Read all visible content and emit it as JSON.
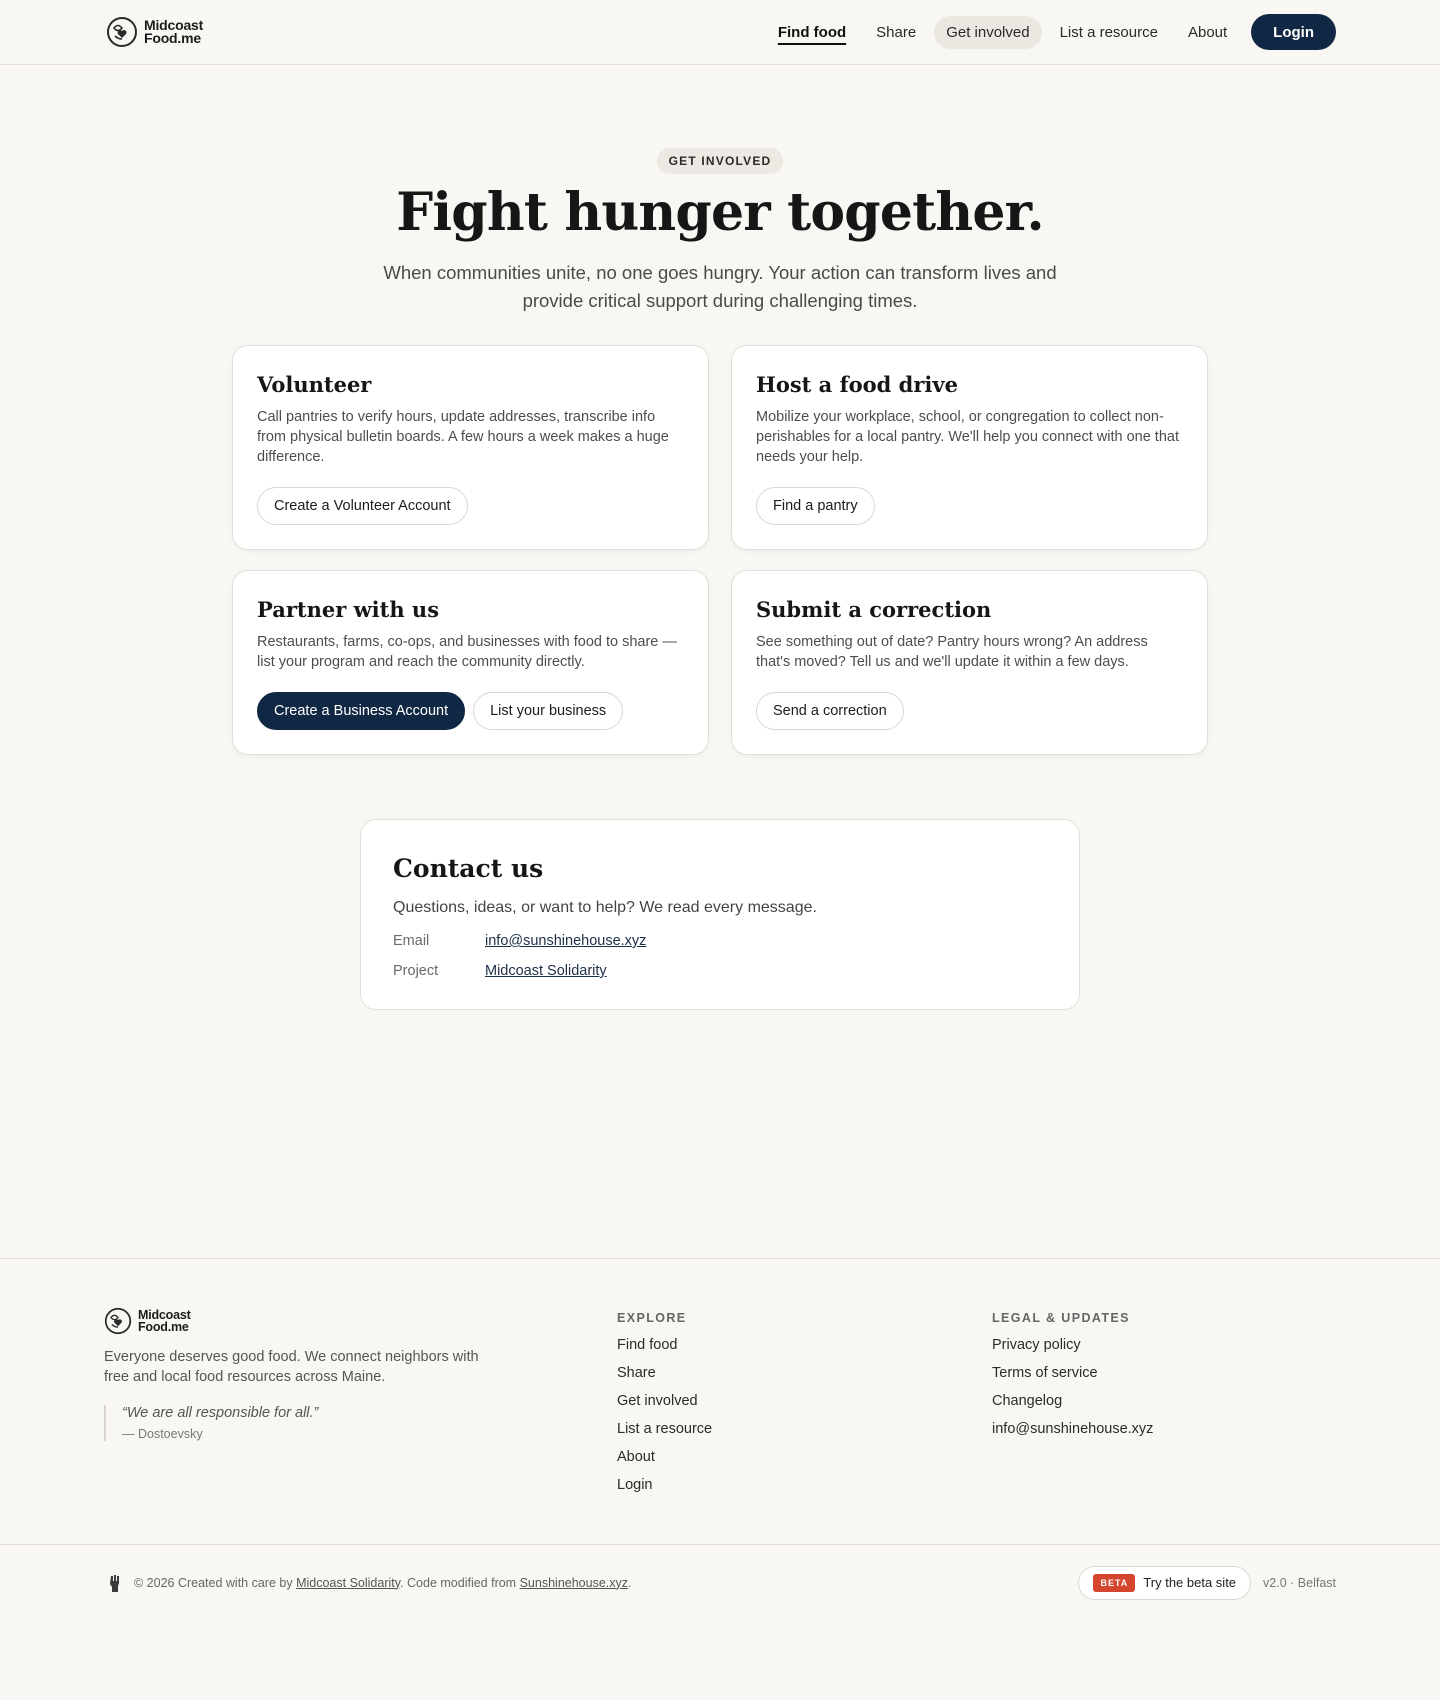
{
  "header": {
    "logo_line1": "Midcoast",
    "logo_line2": "Food.me",
    "nav": [
      {
        "label": "Find food"
      },
      {
        "label": "Share"
      },
      {
        "label": "Get involved"
      },
      {
        "label": "List a resource"
      },
      {
        "label": "About"
      }
    ],
    "login_label": "Login"
  },
  "hero": {
    "eyebrow": "GET INVOLVED",
    "title": "Fight hunger together.",
    "subtitle": "When communities unite, no one goes hungry. Your action can transform lives and provide critical support during challenging times."
  },
  "cards": [
    {
      "title": "Volunteer",
      "text": "Call pantries to verify hours, update addresses, transcribe info from physical bulletin boards. A few hours a week makes a huge difference.",
      "button": "Create a Volunteer Account"
    },
    {
      "title": "Host a food drive",
      "text": "Mobilize your workplace, school, or congregation to collect non-perishables for a local pantry. We'll help you connect with one that needs your help.",
      "button": "Find a pantry"
    },
    {
      "title": "Partner with us",
      "text": "Restaurants, farms, co-ops, and businesses with food to share — list your program and reach the community directly.",
      "button_primary": "Create a Business Account",
      "button": "List your business"
    },
    {
      "title": "Submit a correction",
      "text": "See something out of date? Pantry hours wrong? An address that's moved? Tell us and we'll update it within a few days.",
      "button": "Send a correction"
    }
  ],
  "contact": {
    "title": "Contact us",
    "subtitle": "Questions, ideas, or want to help? We read every message.",
    "email_label": "Email",
    "email_value": "info@sunshinehouse.xyz",
    "project_label": "Project",
    "project_value": "Midcoast Solidarity"
  },
  "footer": {
    "description": "Everyone deserves good food. We connect neighbors with free and local food resources across Maine.",
    "quote": "“We are all responsible for all.”",
    "quote_author": "— Dostoevsky",
    "explore_heading": "EXPLORE",
    "explore_links": [
      "Find food",
      "Share",
      "Get involved",
      "List a resource",
      "About",
      "Login"
    ],
    "legal_heading": "LEGAL & UPDATES",
    "legal_links": [
      "Privacy policy",
      "Terms of service",
      "Changelog",
      "info@sunshinehouse.xyz"
    ],
    "copyright_prefix": "© 2026 Created with care by",
    "copyright_link1": "Midcoast Solidarity",
    "copyright_middle": ". Code modified from",
    "copyright_link2": "Sunshinehouse.xyz",
    "copyright_suffix": ".",
    "beta_badge": "BETA",
    "beta_label": "Try the beta site",
    "version": "v2.0 · Belfast"
  },
  "colors": {
    "background": "#f9f7f3",
    "navy": "#112845",
    "beta_red": "#d6452e"
  },
  "icons": {
    "logo": "heart-leaf-circle-icon",
    "fist": "raised-fist-icon"
  }
}
